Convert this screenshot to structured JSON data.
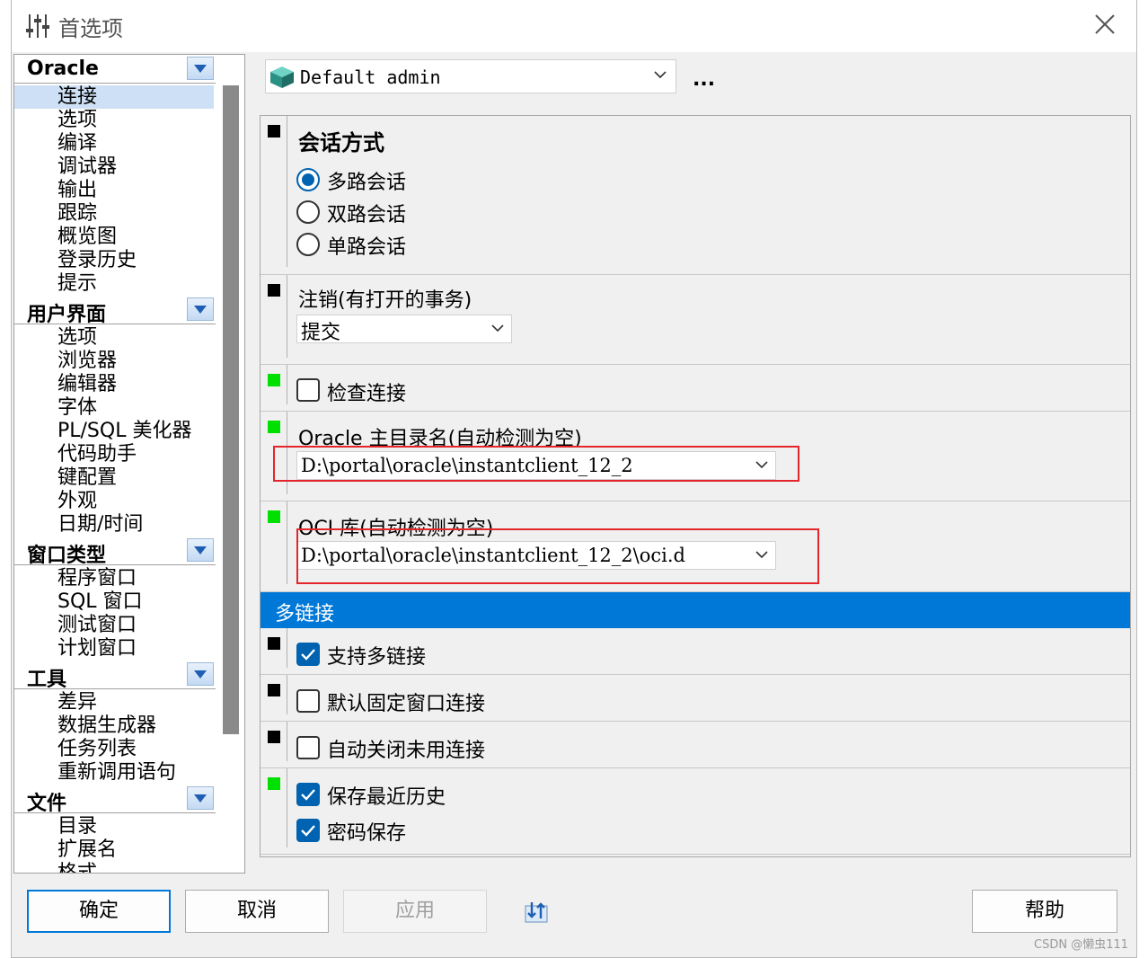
{
  "window": {
    "title": "首选项"
  },
  "nav": {
    "groups": [
      {
        "label": "Oracle",
        "items": [
          "连接",
          "选项",
          "编译",
          "调试器",
          "输出",
          "跟踪",
          "概览图",
          "登录历史",
          "提示"
        ]
      },
      {
        "label": "用户界面",
        "items": [
          "选项",
          "浏览器",
          "编辑器",
          "字体",
          "PL/SQL 美化器",
          "代码助手",
          "键配置",
          "外观",
          "日期/时间"
        ]
      },
      {
        "label": "窗口类型",
        "items": [
          "程序窗口",
          "SQL 窗口",
          "测试窗口",
          "计划窗口"
        ]
      },
      {
        "label": "工具",
        "items": [
          "差异",
          "数据生成器",
          "任务列表",
          "重新调用语句"
        ]
      },
      {
        "label": "文件",
        "items": [
          "目录",
          "扩展名",
          "格式"
        ]
      }
    ],
    "selected": "连接"
  },
  "profile": {
    "value": "Default admin",
    "more": "..."
  },
  "session": {
    "title": "会话方式",
    "options": [
      "多路会话",
      "双路会话",
      "单路会话"
    ],
    "selected_index": 0
  },
  "logoff": {
    "title": "注销(有打开的事务)",
    "value": "提交"
  },
  "check_connection": {
    "label": "检查连接",
    "checked": false
  },
  "oracle_home": {
    "title": "Oracle 主目录名(自动检测为空)",
    "value": "D:\\portal\\oracle\\instantclient_12_2"
  },
  "oci_library": {
    "title": "OCI 库(自动检测为空)",
    "value": "D:\\portal\\oracle\\instantclient_12_2\\oci.d"
  },
  "multi_connection": {
    "title": "多链接",
    "support": {
      "label": "支持多链接",
      "checked": true
    },
    "default_fixed": {
      "label": "默认固定窗口连接",
      "checked": false
    },
    "auto_close": {
      "label": "自动关闭未用连接",
      "checked": false
    }
  },
  "history": {
    "save_recent": {
      "label": "保存最近历史",
      "checked": true
    },
    "save_password": {
      "label": "密码保存",
      "checked": true
    }
  },
  "buttons": {
    "ok": "确定",
    "cancel": "取消",
    "apply": "应用",
    "help": "帮助"
  },
  "watermark": "CSDN @懒虫111",
  "colors": {
    "accent": "#0078d7",
    "marker_black": "#000000",
    "marker_green": "#00e000",
    "highlight_red": "#e3262a"
  }
}
